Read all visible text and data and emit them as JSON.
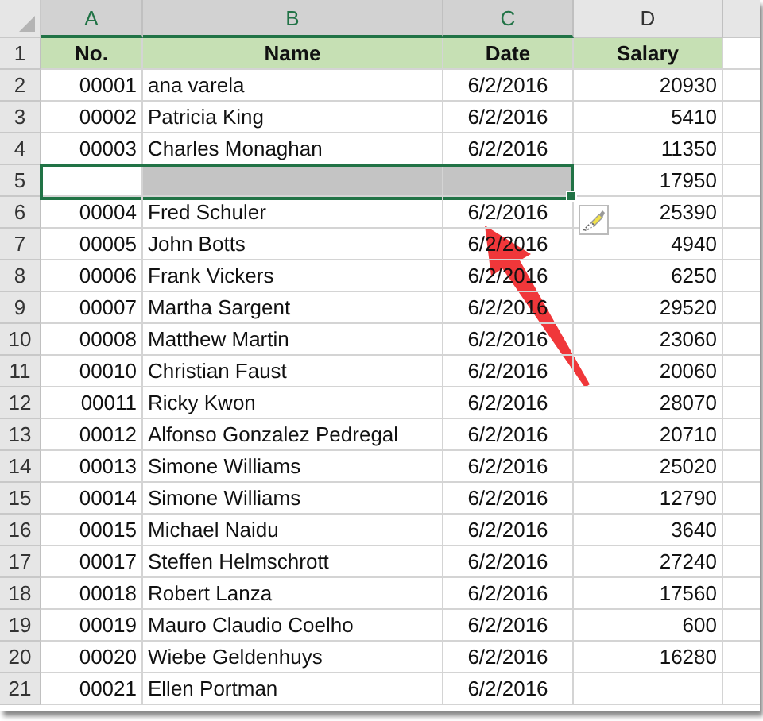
{
  "columns": [
    {
      "label": "A",
      "selected": true
    },
    {
      "label": "B",
      "selected": true
    },
    {
      "label": "C",
      "selected": true
    },
    {
      "label": "D",
      "selected": false
    }
  ],
  "rows": [
    {
      "number": "1",
      "kind": "header",
      "selected": false,
      "cells": [
        "No.",
        "Name",
        "Date",
        "Salary"
      ]
    },
    {
      "number": "2",
      "kind": "data",
      "selected": false,
      "cells": [
        "00001",
        "ana varela",
        "6/2/2016",
        "20930"
      ]
    },
    {
      "number": "3",
      "kind": "data",
      "selected": false,
      "cells": [
        "00002",
        "Patricia King",
        "6/2/2016",
        "5410"
      ]
    },
    {
      "number": "4",
      "kind": "data",
      "selected": false,
      "cells": [
        "00003",
        "Charles Monaghan",
        "6/2/2016",
        "11350"
      ]
    },
    {
      "number": "5",
      "kind": "data",
      "selected": true,
      "cells": [
        null,
        null,
        null,
        "17950"
      ]
    },
    {
      "number": "6",
      "kind": "data",
      "selected": false,
      "cells": [
        "00004",
        "Fred Schuler",
        "6/2/2016",
        "25390"
      ]
    },
    {
      "number": "7",
      "kind": "data",
      "selected": false,
      "cells": [
        "00005",
        "John Botts",
        "6/2/2016",
        "4940"
      ]
    },
    {
      "number": "8",
      "kind": "data",
      "selected": false,
      "cells": [
        "00006",
        "Frank Vickers",
        "6/2/2016",
        "6250"
      ]
    },
    {
      "number": "9",
      "kind": "data",
      "selected": false,
      "cells": [
        "00007",
        "Martha Sargent",
        "6/2/2016",
        "29520"
      ]
    },
    {
      "number": "10",
      "kind": "data",
      "selected": false,
      "cells": [
        "00008",
        "Matthew Martin",
        "6/2/2016",
        "23060"
      ]
    },
    {
      "number": "11",
      "kind": "data",
      "selected": false,
      "cells": [
        "00010",
        "Christian Faust",
        "6/2/2016",
        "20060"
      ]
    },
    {
      "number": "12",
      "kind": "data",
      "selected": false,
      "cells": [
        "00011",
        "Ricky Kwon",
        "6/2/2016",
        "28070"
      ]
    },
    {
      "number": "13",
      "kind": "data",
      "selected": false,
      "cells": [
        "00012",
        "Alfonso Gonzalez Pedregal",
        "6/2/2016",
        "20710"
      ]
    },
    {
      "number": "14",
      "kind": "data",
      "selected": false,
      "cells": [
        "00013",
        "Simone Williams",
        "6/2/2016",
        "25020"
      ]
    },
    {
      "number": "15",
      "kind": "data",
      "selected": false,
      "cells": [
        "00014",
        "Simone Williams",
        "6/2/2016",
        "12790"
      ]
    },
    {
      "number": "16",
      "kind": "data",
      "selected": false,
      "cells": [
        "00015",
        "Michael Naidu",
        "6/2/2016",
        "3640"
      ]
    },
    {
      "number": "17",
      "kind": "data",
      "selected": false,
      "cells": [
        "00017",
        "Steffen Helmschrott",
        "6/2/2016",
        "27240"
      ]
    },
    {
      "number": "18",
      "kind": "data",
      "selected": false,
      "cells": [
        "00018",
        "Robert Lanza",
        "6/2/2016",
        "17560"
      ]
    },
    {
      "number": "19",
      "kind": "data",
      "selected": false,
      "cells": [
        "00019",
        "Mauro Claudio Coelho",
        "6/2/2016",
        "600"
      ]
    },
    {
      "number": "20",
      "kind": "data",
      "selected": false,
      "cells": [
        "00020",
        "Wiebe Geldenhuys",
        "6/2/2016",
        "16280"
      ]
    },
    {
      "number": "21",
      "kind": "data",
      "selected": false,
      "cells": [
        "00021",
        "Ellen Portman",
        "6/2/2016",
        null
      ]
    }
  ]
}
